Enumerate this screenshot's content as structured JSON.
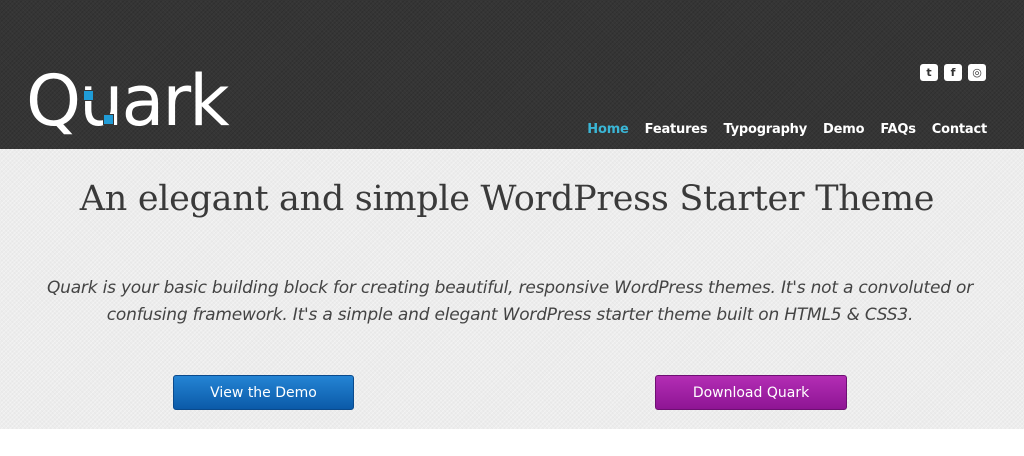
{
  "header": {
    "logo_text": "Quark",
    "social": [
      {
        "name": "twitter-icon",
        "glyph": "t"
      },
      {
        "name": "facebook-icon",
        "glyph": "f"
      },
      {
        "name": "github-icon",
        "glyph": "◎"
      }
    ],
    "nav": [
      "Home",
      "Features",
      "Typography",
      "Demo",
      "FAQs",
      "Contact"
    ],
    "active_nav": "Home"
  },
  "hero": {
    "title": "An elegant and simple WordPress Starter Theme",
    "description": "Quark is your basic building block for creating beautiful, responsive WordPress themes. It's not a convoluted or confusing framework. It's a simple and elegant WordPress starter theme built on HTML5 & CSS3.",
    "demo_button": "View the Demo",
    "download_button": "Download Quark"
  },
  "colors": {
    "header_bg": "#353535",
    "nav_active": "#3ab6d6",
    "demo_button": "#1a6fc0",
    "download_button": "#a020a6",
    "logo_accent": "#1f9bd6"
  }
}
